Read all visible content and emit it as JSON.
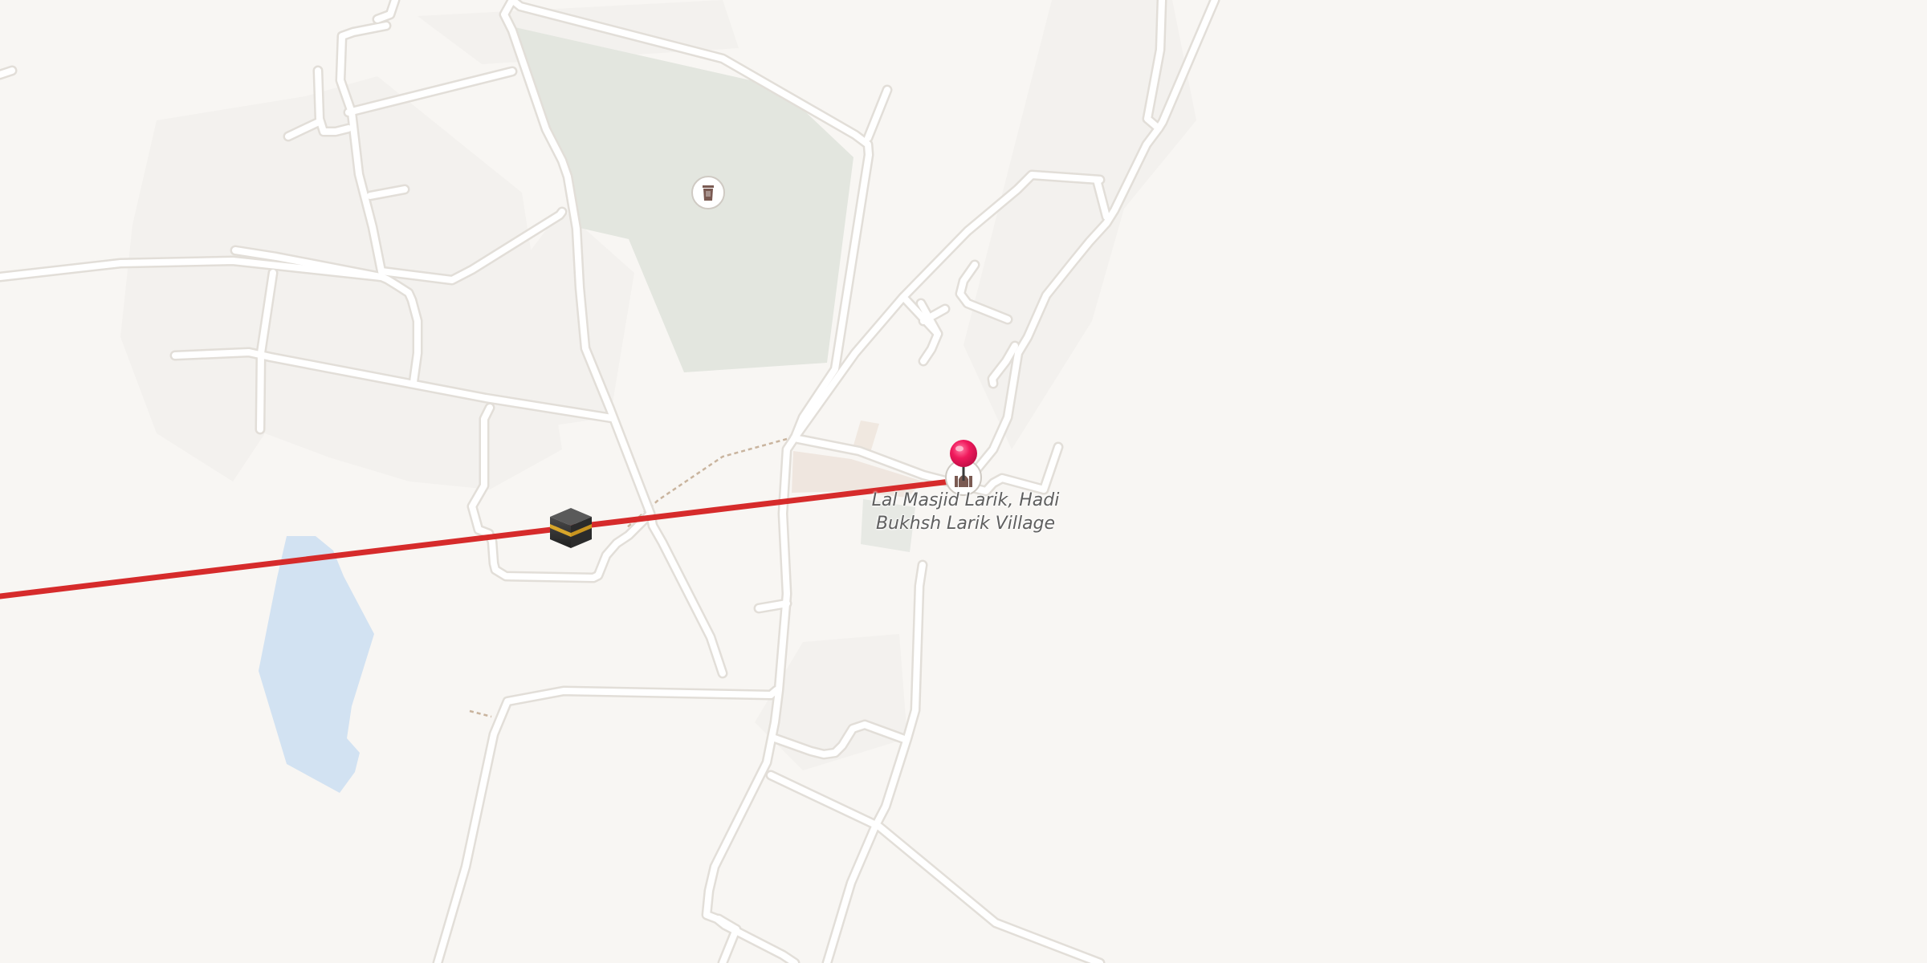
{
  "map": {
    "poi_label": "Lal Masjid Larik, Hadi Bukhsh Larik Village",
    "icons": {
      "kaaba": "kaaba-icon",
      "mosque": "mosque-icon",
      "monument": "monument-icon",
      "pin": "location-pin-icon"
    },
    "colors": {
      "background": "#f8f6f3",
      "road_casing": "#e2ded8",
      "road_fill": "#ffffff",
      "park": "#e3e6df",
      "water": "#d2e2f2",
      "qibla_line": "#d62b2b",
      "pin": "#f0195c",
      "path_dashed": "#c9b49e"
    }
  }
}
